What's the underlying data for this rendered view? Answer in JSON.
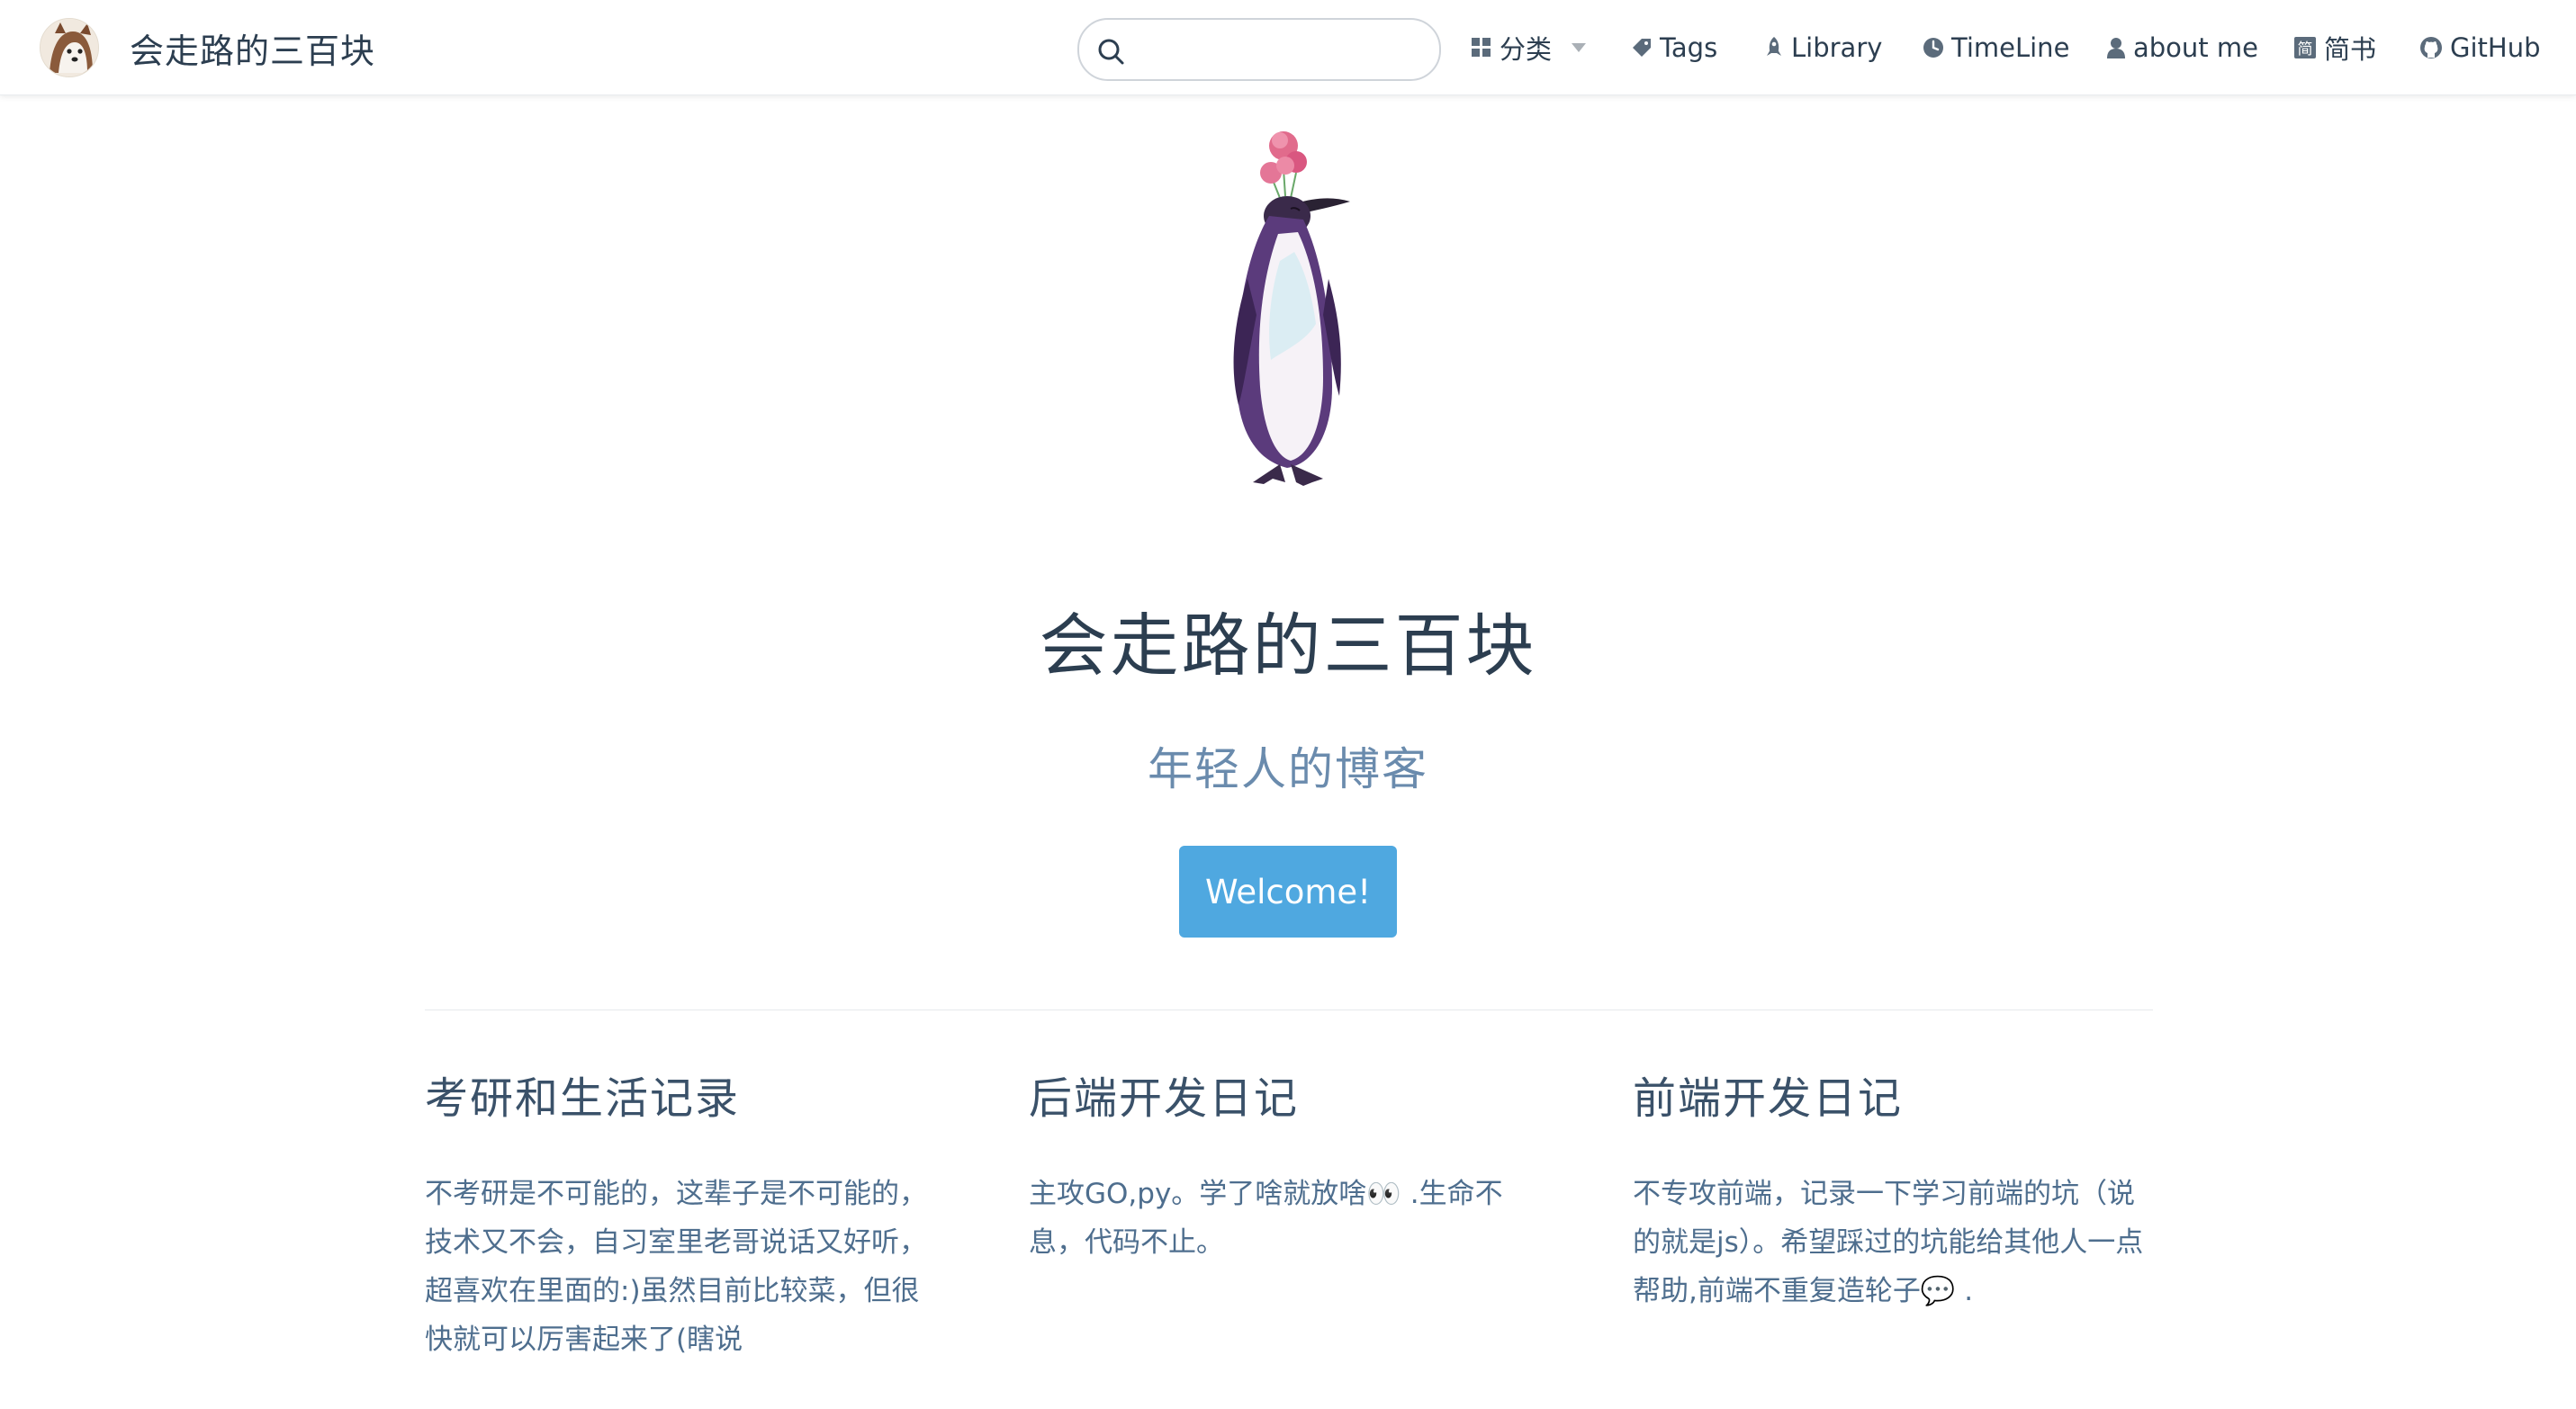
{
  "site": {
    "title": "会走路的三百块",
    "avatar_icon": "shiba-dog-avatar"
  },
  "search": {
    "placeholder": "",
    "value": ""
  },
  "nav": {
    "items": [
      {
        "label": "分类",
        "icon": "grid-icon",
        "dropdown": true
      },
      {
        "label": "Tags",
        "icon": "tag-icon"
      },
      {
        "label": "Library",
        "icon": "rocket-icon"
      },
      {
        "label": "TimeLine",
        "icon": "clock-icon"
      },
      {
        "label": "about me",
        "icon": "user-icon"
      },
      {
        "label": "简书",
        "icon": "jianshu-icon"
      },
      {
        "label": "GitHub",
        "icon": "github-icon"
      }
    ]
  },
  "hero": {
    "image_icon": "penguin-with-flowers",
    "title": "会走路的三百块",
    "subtitle": "年轻人的博客",
    "button_label": "Welcome!"
  },
  "features": [
    {
      "title": "考研和生活记录",
      "body": "不考研是不可能的，这辈子是不可能的，技术又不会，自习室里老哥说话又好听，超喜欢在里面的:)虽然目前比较菜，但很快就可以厉害起来了(瞎说"
    },
    {
      "title": "后端开发日记",
      "body": "主攻GO,py。学了啥就放啥👀 .生命不息，代码不止。"
    },
    {
      "title": "前端开发日记",
      "body": "不专攻前端，记录一下学习前端的坑（说的就是js）。希望踩过的坑能给其他人一点帮助,前端不重复造轮子💬 ."
    }
  ],
  "colors": {
    "accent": "#4fa8e0",
    "text": "#2c3e50",
    "subtitle": "#6a8bad",
    "body": "#4e6e8e"
  }
}
